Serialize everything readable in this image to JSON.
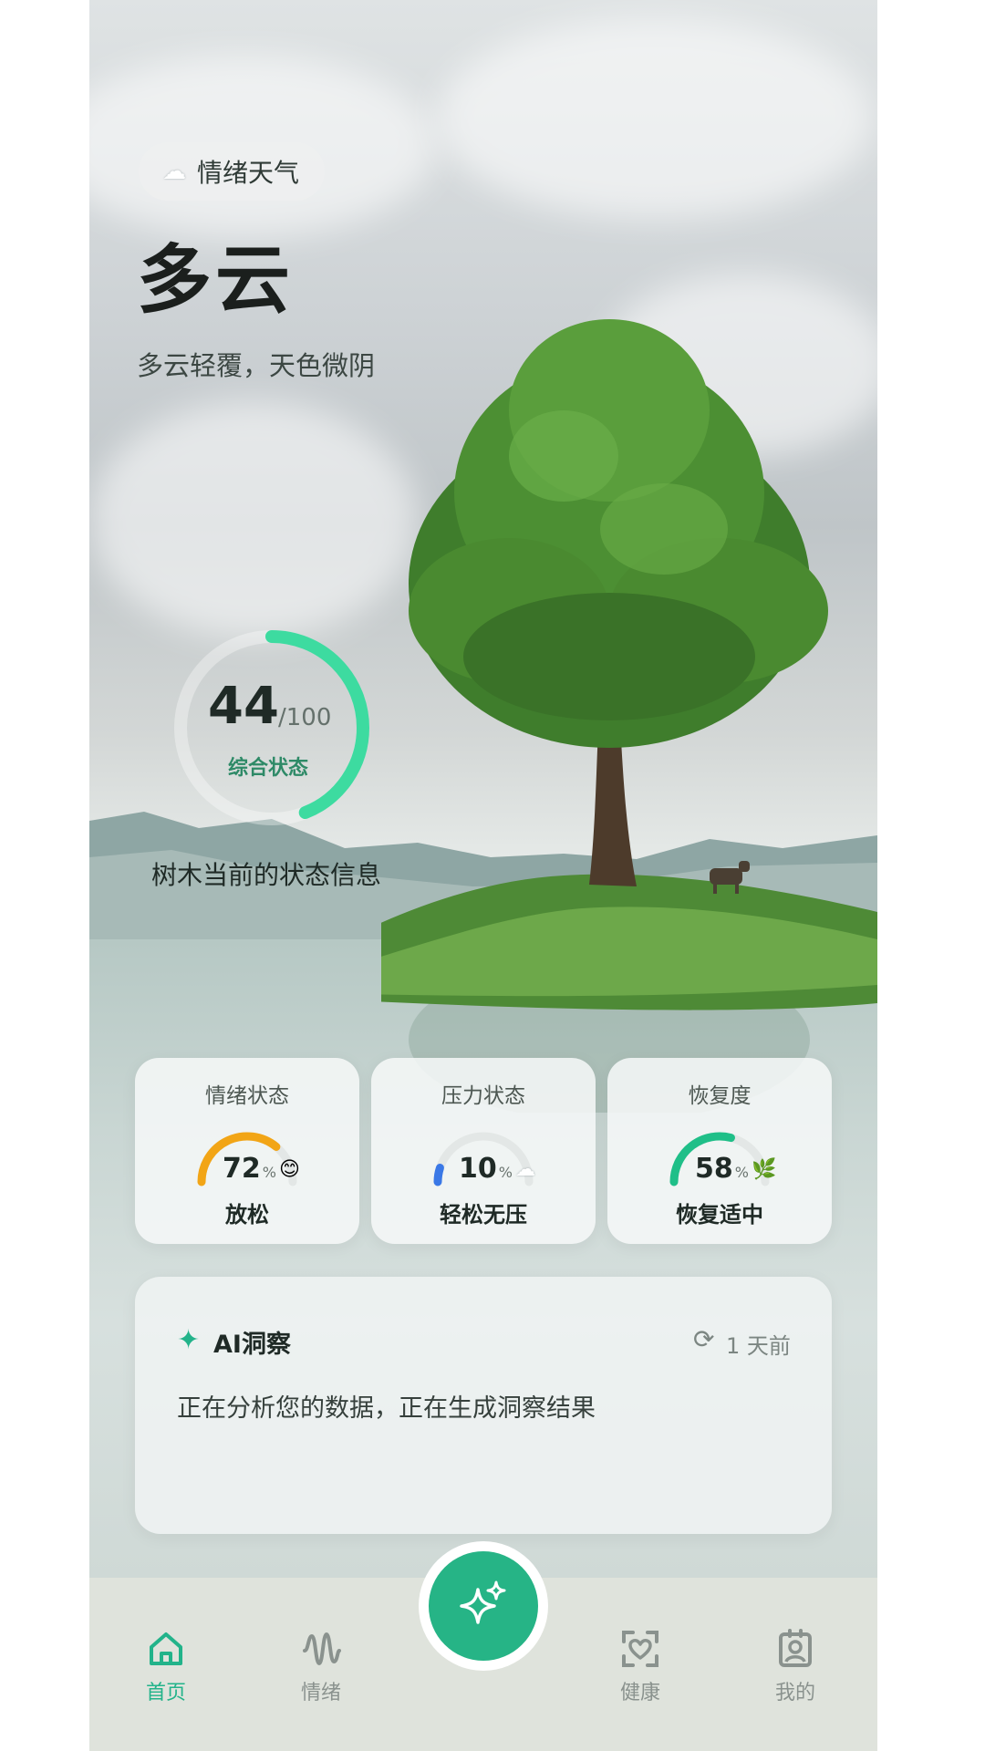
{
  "header": {
    "pill_label": "情绪天气",
    "weather": "多云",
    "description": "多云轻覆，天色微阴"
  },
  "score": {
    "value": "44",
    "max": "/100",
    "label": "综合状态",
    "fraction": 0.44,
    "tree_info": "树木当前的状态信息"
  },
  "stats": [
    {
      "title": "情绪状态",
      "value": "72",
      "unit": "%",
      "state": "放松",
      "fraction": 0.72,
      "color": "#f2a516",
      "icon": "smile-icon",
      "glyph": "😊"
    },
    {
      "title": "压力状态",
      "value": "10",
      "unit": "%",
      "state": "轻松无压",
      "fraction": 0.1,
      "color": "#3a78e6",
      "icon": "cloud-icon",
      "glyph": "☁"
    },
    {
      "title": "恢复度",
      "value": "58",
      "unit": "%",
      "state": "恢复适中",
      "fraction": 0.58,
      "color": "#1fbf88",
      "icon": "leaf-icon",
      "glyph": "🌿"
    }
  ],
  "ai": {
    "title": "AI洞察",
    "time": "1 天前",
    "body": "正在分析您的数据，正在生成洞察结果"
  },
  "nav": {
    "home": "首页",
    "mood": "情绪",
    "health": "健康",
    "me": "我的"
  },
  "colors": {
    "accent": "#22b38a",
    "ring": "#3ddba0"
  }
}
